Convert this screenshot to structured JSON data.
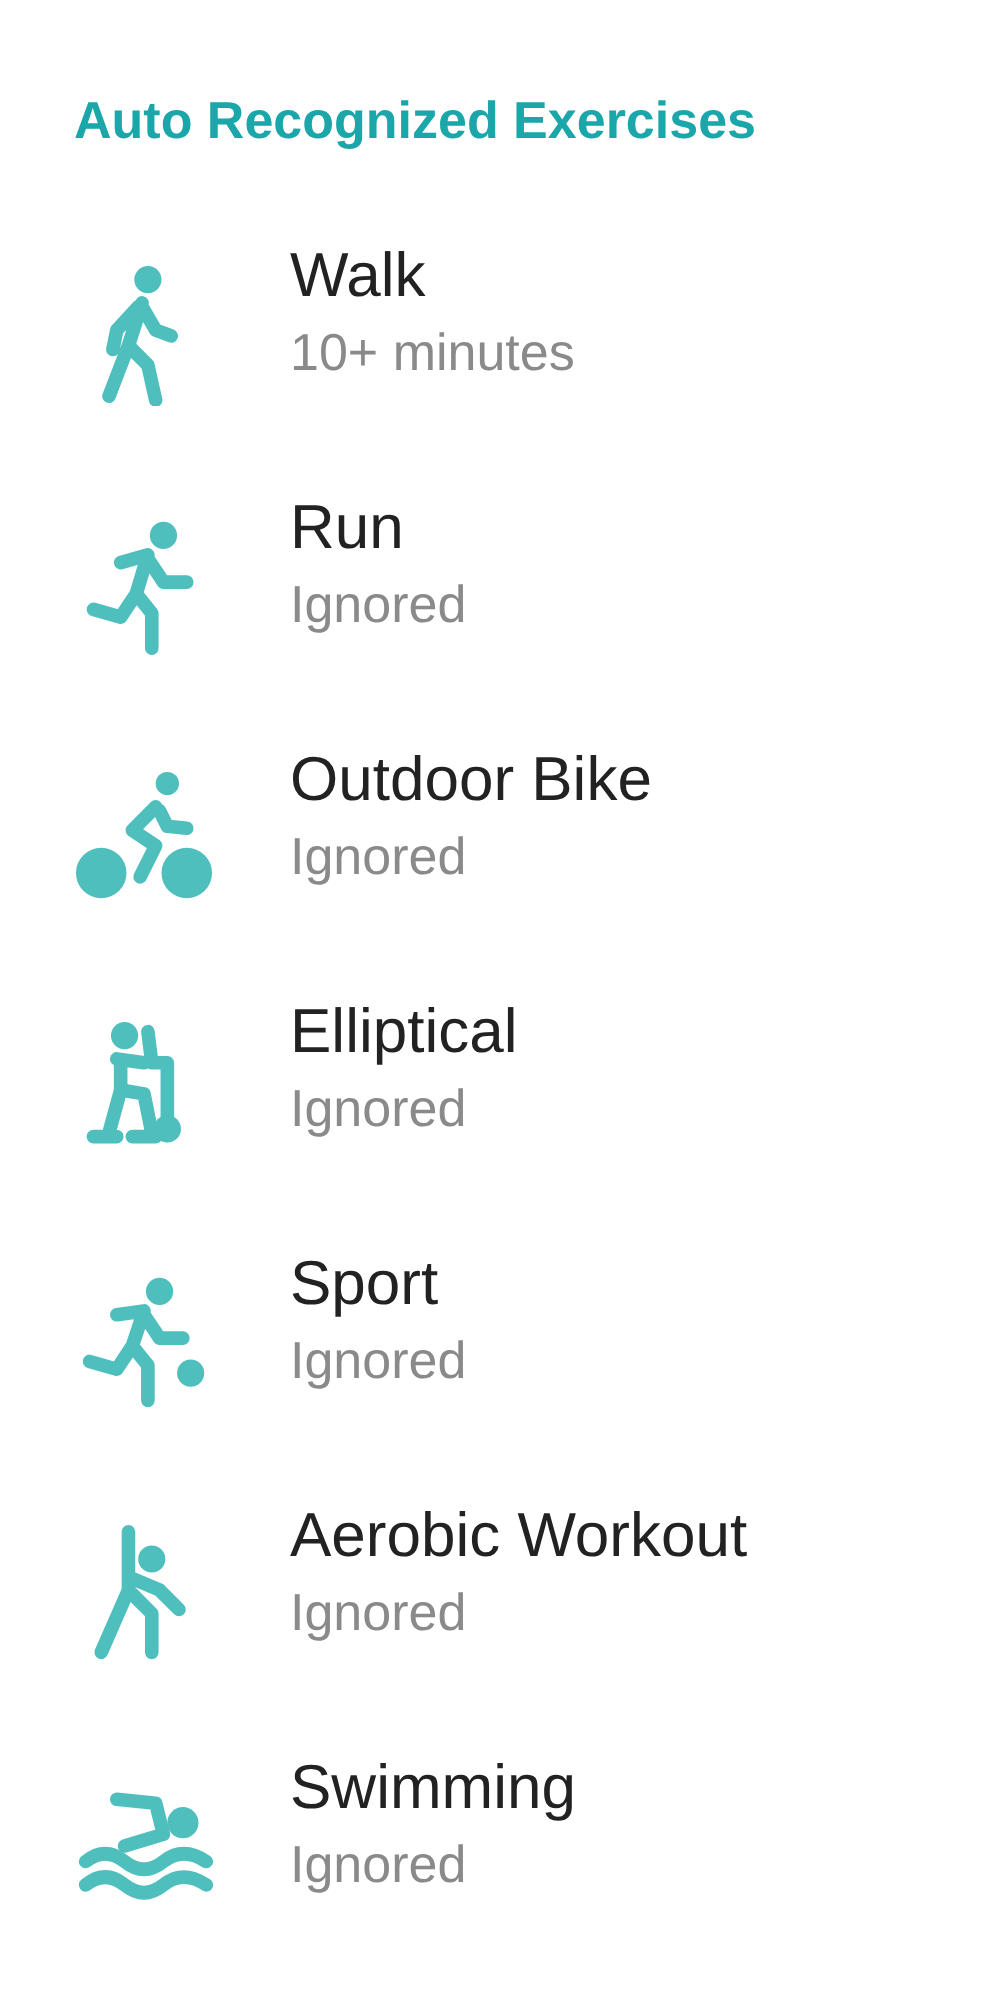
{
  "title": "Auto Recognized Exercises",
  "exercises": [
    {
      "kind": "walk",
      "name": "Walk",
      "status": "10+ minutes"
    },
    {
      "kind": "run",
      "name": "Run",
      "status": "Ignored"
    },
    {
      "kind": "bike",
      "name": "Outdoor Bike",
      "status": "Ignored"
    },
    {
      "kind": "elliptical",
      "name": "Elliptical",
      "status": "Ignored"
    },
    {
      "kind": "sport",
      "name": "Sport",
      "status": "Ignored"
    },
    {
      "kind": "aerobic",
      "name": "Aerobic Workout",
      "status": "Ignored"
    },
    {
      "kind": "swim",
      "name": "Swimming",
      "status": "Ignored"
    }
  ]
}
